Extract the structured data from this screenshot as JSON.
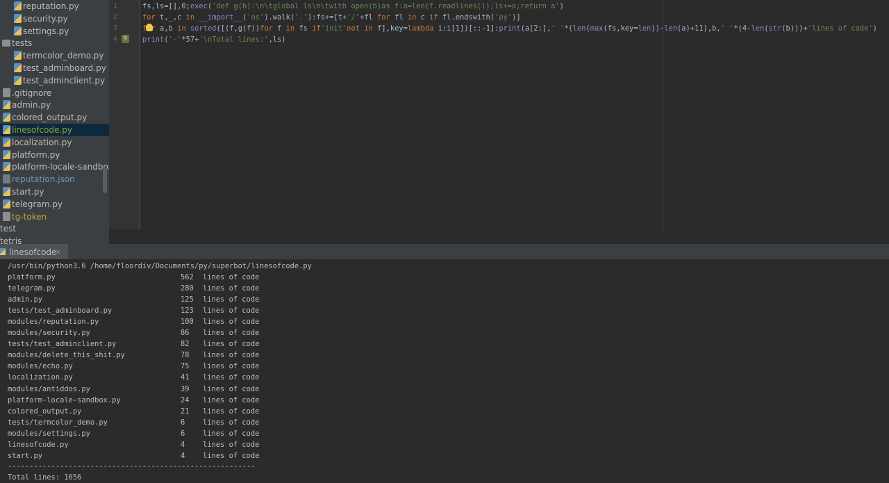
{
  "project_tree": {
    "items": [
      {
        "label": "reputation.py",
        "type": "py"
      },
      {
        "label": "security.py",
        "type": "py"
      },
      {
        "label": "settings.py",
        "type": "py"
      },
      {
        "label": "tests",
        "type": "folder"
      },
      {
        "label": "termcolor_demo.py",
        "type": "py"
      },
      {
        "label": "test_adminboard.py",
        "type": "py"
      },
      {
        "label": "test_adminclient.py",
        "type": "py"
      },
      {
        "label": ".gitignore",
        "type": "txt"
      },
      {
        "label": "admin.py",
        "type": "py"
      },
      {
        "label": "colored_output.py",
        "type": "py"
      },
      {
        "label": "linesofcode.py",
        "type": "py",
        "selected": true
      },
      {
        "label": "localization.py",
        "type": "py"
      },
      {
        "label": "platform.py",
        "type": "py"
      },
      {
        "label": "platform-locale-sandbox.p",
        "type": "py"
      },
      {
        "label": "reputation.json",
        "type": "json"
      },
      {
        "label": "start.py",
        "type": "py"
      },
      {
        "label": "telegram.py",
        "type": "py"
      },
      {
        "label": "tg-token",
        "type": "txt"
      },
      {
        "label": "test",
        "type": "plain"
      },
      {
        "label": "tetris",
        "type": "plain"
      }
    ]
  },
  "editor": {
    "line_numbers": [
      "1",
      "2",
      "3",
      "4"
    ],
    "breakpoint_badge": "9",
    "lines": [
      "fs,ls=[],0;exec('def g(b):\\n\\tglobal ls\\n\\twith open(b)as f:a=len(f.readlines());ls+=a;return a')",
      "for t,_,c in __import__('os').walk('.'):fs+=[t+'/'+fl for fl in c if fl.endswith('py')]",
      "for a,b in sorted([(f,g(f))for f in fs if'init'not in f],key=lambda i:i[1])[::-1]:print(a[2:],' '*(len(max(fs,key=len))-len(a)+11),b,' '*(4-len(str(b)))+'lines of code')",
      "print('-'*57+'\\nTotal lines:',ls)"
    ]
  },
  "run_panel": {
    "tab_label": "linesofcode",
    "tab_close": "×",
    "command": "/usr/bin/python3.6 /home/floordiv/Documents/py/superbot/linesofcode.py",
    "rows": [
      {
        "file": "platform.py",
        "count": "562",
        "suffix": "lines of code"
      },
      {
        "file": "telegram.py",
        "count": "280",
        "suffix": "lines of code"
      },
      {
        "file": "admin.py",
        "count": "125",
        "suffix": "lines of code"
      },
      {
        "file": "tests/test_adminboard.py",
        "count": "123",
        "suffix": "lines of code"
      },
      {
        "file": "modules/reputation.py",
        "count": "100",
        "suffix": "lines of code"
      },
      {
        "file": "modules/security.py",
        "count": "86",
        "suffix": "lines of code"
      },
      {
        "file": "tests/test_adminclient.py",
        "count": "82",
        "suffix": "lines of code"
      },
      {
        "file": "modules/delete_this_shit.py",
        "count": "78",
        "suffix": "lines of code"
      },
      {
        "file": "modules/echo.py",
        "count": "75",
        "suffix": "lines of code"
      },
      {
        "file": "localization.py",
        "count": "41",
        "suffix": "lines of code"
      },
      {
        "file": "modules/antiddos.py",
        "count": "39",
        "suffix": "lines of code"
      },
      {
        "file": "platform-locale-sandbox.py",
        "count": "24",
        "suffix": "lines of code"
      },
      {
        "file": "colored_output.py",
        "count": "21",
        "suffix": "lines of code"
      },
      {
        "file": "tests/termcolor_demo.py",
        "count": "6",
        "suffix": "lines of code"
      },
      {
        "file": "modules/settings.py",
        "count": "6",
        "suffix": "lines of code"
      },
      {
        "file": "linesofcode.py",
        "count": "4",
        "suffix": "lines of code"
      },
      {
        "file": "start.py",
        "count": "4",
        "suffix": "lines of code"
      }
    ],
    "separator": "---------------------------------------------------------",
    "total_line": "Total lines: 1656"
  },
  "colors": {
    "py_icon_blue": "#5a8fc7",
    "py_icon_yellow": "#e3c35a",
    "json_text": "#6897bb",
    "untracked_text": "#c3a349",
    "selected_text": "#8ba62b",
    "keyword": "#cc7832",
    "string": "#6a8759",
    "builtin": "#8888c6"
  }
}
